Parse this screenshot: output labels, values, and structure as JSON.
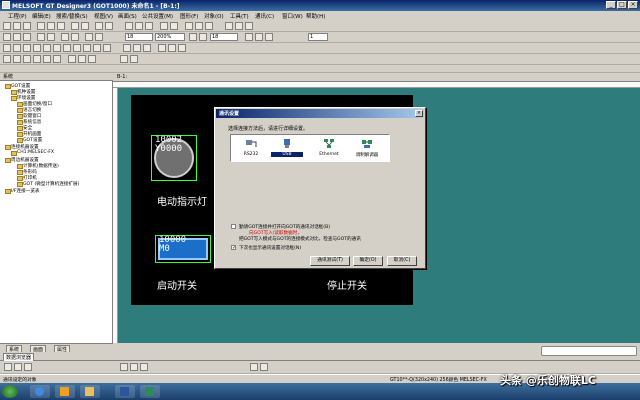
{
  "window": {
    "title": "MELSOFT GT Designer3 (GOT1000) 未命名1 - [B-1:]"
  },
  "menu": [
    "工程(P)",
    "编辑(E)",
    "搜索/替换(S)",
    "视图(V)",
    "画面(S)",
    "公共设置(M)",
    "图形(F)",
    "对象(O)",
    "工具(T)",
    "通讯(C)",
    "窗口(W)",
    "帮助(H)"
  ],
  "toolbar": {
    "zoom": "200%",
    "font_size_1": "18",
    "font_size_2": "18",
    "grid": "1"
  },
  "left_panel": {
    "header": "系统",
    "tree": [
      "GOT设置",
      "机种设置",
      "环境设置",
      "画面切换/窗口",
      "语言切换",
      "软键窗口",
      "系统信息",
      "安全",
      "开机画面",
      "GOT设置",
      "连接机器设置",
      "CH1:MELSEC-FX",
      "周边机器设置",
      "计算机(数据传送)",
      "条形码",
      "打印机",
      "GOT (微型计算机连接扩展)",
      "I/F连接一览表"
    ],
    "tabs": [
      "系统",
      "画面",
      "属性"
    ]
  },
  "workspace": {
    "tab_title": "B-1:",
    "lamp": {
      "code": "10002",
      "device": "Y0000",
      "label": "电动指示灯"
    },
    "switch": {
      "code": "10000",
      "device": "M0",
      "label": "启动开关"
    },
    "stop_label": "停止开关"
  },
  "dialog": {
    "title": "通讯设置",
    "prompt": "选择连接方法后，请进行详细设置。",
    "options": [
      {
        "label": "RS232",
        "icon": "serial-cable-icon"
      },
      {
        "label": "USB",
        "icon": "usb-icon"
      },
      {
        "label": "Ethernet",
        "icon": "ethernet-icon"
      },
      {
        "label": "调制解调器",
        "icon": "modem-icon"
      }
    ],
    "check1": "勤请GOT连接并打开向GOT的通讯对话框(B)",
    "check1_warn": "向GOT写入/读取数据时，",
    "check2": "把GOT写入模式与GOT的连接模式对比，检查与GOT的通讯",
    "check3": "下次也显示通讯设置对话框(N)",
    "buttons": {
      "test": "通讯测试(T)",
      "ok": "确定(O)",
      "cancel": "取消(C)"
    }
  },
  "bottom": {
    "tab": "数据浏览器",
    "status_left": "通讯设定的对象",
    "status_right": "GT10**-Q(320x240) 256颜色  MELSEC-FX"
  },
  "watermark": "头条 @乐创物联LC",
  "colors": {
    "workspace_bg": "#2e7c7c",
    "screen_bg": "#000000",
    "switch_blue": "#1b6fc9",
    "object_border": "#3cff3c",
    "titlebar": "#0a246a"
  }
}
